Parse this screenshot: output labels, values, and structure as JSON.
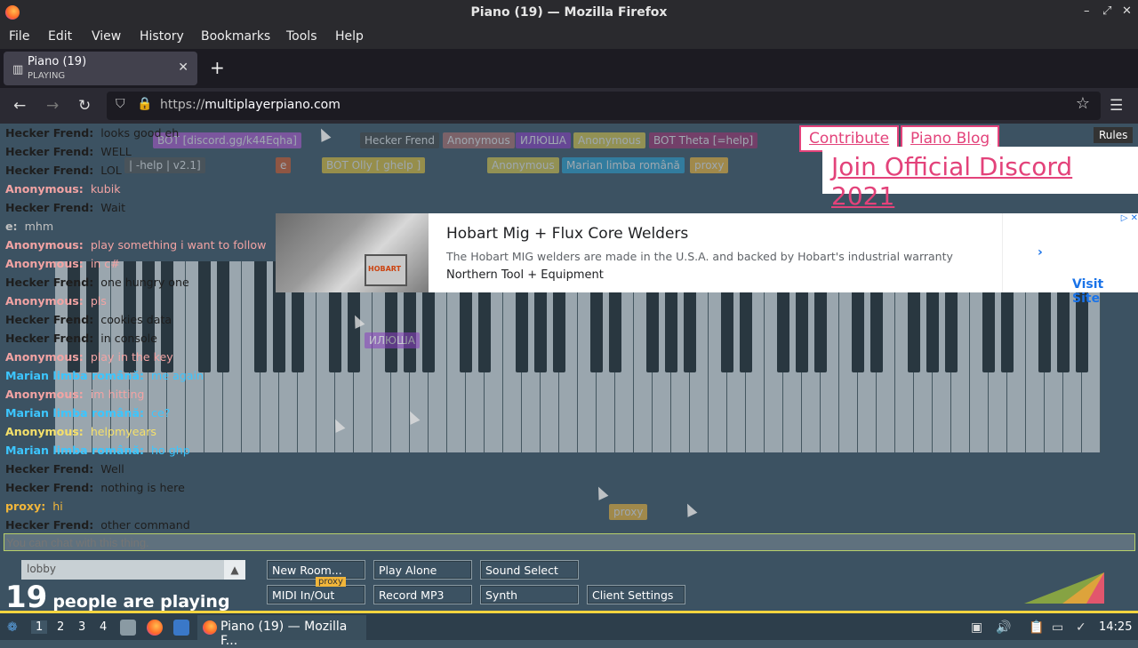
{
  "window": {
    "title": "Piano (19) — Mozilla Firefox"
  },
  "menu": [
    "File",
    "Edit",
    "View",
    "History",
    "Bookmarks",
    "Tools",
    "Help"
  ],
  "tab": {
    "title": "Piano (19)",
    "subtitle": "PLAYING"
  },
  "url": {
    "scheme": "https://",
    "host": "multiplayerpiano.com"
  },
  "links": {
    "contribute": "Contribute",
    "blog": "Piano Blog",
    "discord": "Join Official Discord 2021",
    "rules": "Rules"
  },
  "ad": {
    "headline": "Hobart Mig + Flux Core Welders",
    "description": "The Hobart MIG welders are made in the U.S.A. and backed by Hobart's industrial warranty",
    "advertiser": "Northern Tool + Equipment",
    "cta": "Visit Site",
    "brand": "HOBART"
  },
  "chat": [
    {
      "who": "Hecker Frend:",
      "msg": "looks good eh",
      "color": "#1e1e1e"
    },
    {
      "who": "Hecker Frend:",
      "msg": "WELL",
      "color": "#1e1e1e"
    },
    {
      "who": "Hecker Frend:",
      "msg": "LOL",
      "color": "#1e1e1e"
    },
    {
      "who": "Anonymous:",
      "msg": "kubik",
      "color": "#f2a3a3"
    },
    {
      "who": "Hecker Frend:",
      "msg": "Wait",
      "color": "#1e1e1e"
    },
    {
      "who": "e:",
      "msg": "mhm",
      "color": "#c0c0c0"
    },
    {
      "who": "Anonymous:",
      "msg": "play something i want to follow",
      "color": "#f2a3a3"
    },
    {
      "who": "Anonymous:",
      "msg": "in c#",
      "color": "#f2a3a3"
    },
    {
      "who": "Hecker Frend:",
      "msg": "one hungry one",
      "color": "#1e1e1e"
    },
    {
      "who": "Anonymous:",
      "msg": "pls",
      "color": "#f2a3a3"
    },
    {
      "who": "Hecker Frend:",
      "msg": "cookies data",
      "color": "#1e1e1e"
    },
    {
      "who": "Hecker Frend:",
      "msg": "in console",
      "color": "#1e1e1e"
    },
    {
      "who": "Anonymous:",
      "msg": "play in the key",
      "color": "#f2a3a3"
    },
    {
      "who": "Marian limba română:",
      "msg": "me again",
      "color": "#3cc6ff"
    },
    {
      "who": "Anonymous:",
      "msg": "im hitting",
      "color": "#f2a3a3"
    },
    {
      "who": "Marian limba română:",
      "msg": "ce?",
      "color": "#3cc6ff"
    },
    {
      "who": "Anonymous:",
      "msg": "helpmyears",
      "color": "#f5e06a"
    },
    {
      "who": "Marian limba română:",
      "msg": "ho ghp",
      "color": "#3cc6ff"
    },
    {
      "who": "Hecker Frend:",
      "msg": "Well",
      "color": "#1e1e1e"
    },
    {
      "who": "Hecker Frend:",
      "msg": "nothing is here",
      "color": "#1e1e1e"
    },
    {
      "who": "proxy:",
      "msg": "hi",
      "color": "#f2b63a"
    },
    {
      "who": "Hecker Frend:",
      "msg": "other command",
      "color": "#1e1e1e"
    }
  ],
  "ghost_users": [
    {
      "label": "BOT [discord.gg/k44Eqha]",
      "color": "#b05ad0"
    },
    {
      "label": "Hecker Frend",
      "color": "#444"
    },
    {
      "label": "Anonymous",
      "color": "#b07070"
    },
    {
      "label": "ИЛЮША",
      "color": "#8a3fc0"
    },
    {
      "label": "Anonymous",
      "color": "#d9c64a"
    },
    {
      "label": "BOT Theta [=help]",
      "color": "#a03070"
    },
    {
      "label": "| -help | v2.1]",
      "color": "#555"
    },
    {
      "label": "e",
      "color": "#d45a2a"
    },
    {
      "label": "BOT Olly [ ghelp ]",
      "color": "#e0c03a"
    },
    {
      "label": "Anonymous",
      "color": "#d9c64a"
    },
    {
      "label": "Marian limba română",
      "color": "#2aa0d0"
    },
    {
      "label": "proxy",
      "color": "#f2b63a"
    }
  ],
  "chat_input": {
    "placeholder": "You can chat with this thing."
  },
  "room": {
    "name": "lobby",
    "count": "19",
    "count_label": "people are playing"
  },
  "buttons": {
    "new_room": "New Room...",
    "play_alone": "Play Alone",
    "sound_select": "Sound Select",
    "midi": "MIDI In/Out",
    "record": "Record MP3",
    "synth": "Synth",
    "client_settings": "Client Settings",
    "proxy_tag": "proxy"
  },
  "taskbar": {
    "workspaces": [
      "1",
      "2",
      "3",
      "4"
    ],
    "window": "Piano (19) — Mozilla F...",
    "clock": "14:25"
  }
}
